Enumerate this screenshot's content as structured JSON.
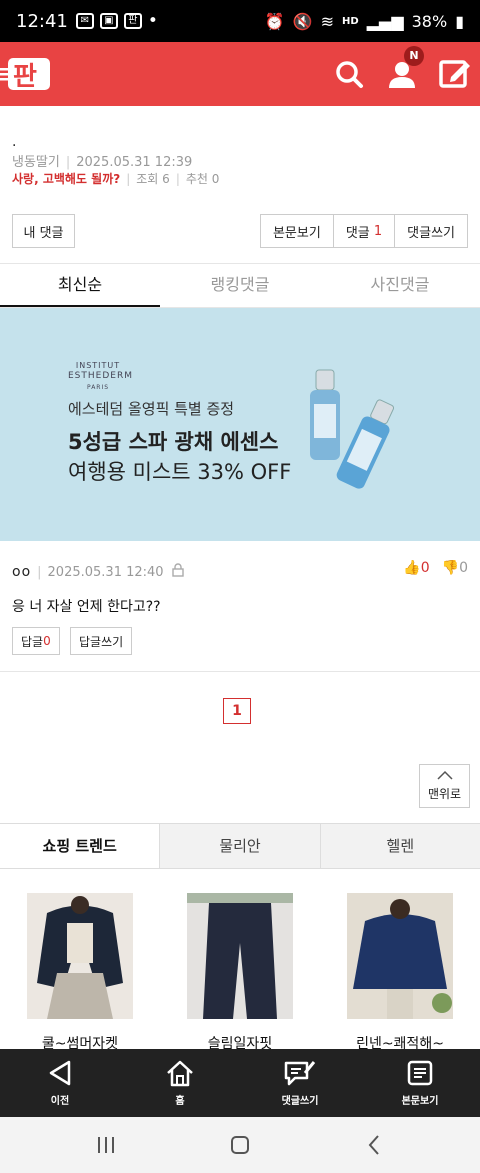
{
  "status_bar": {
    "time": "12:41",
    "battery": "38%",
    "network": "HD"
  },
  "app_bar": {
    "logo_text": "판",
    "notification_badge": "N"
  },
  "post": {
    "title": ".",
    "author": "냉동딸기",
    "datetime": "2025.05.31 12:39",
    "category": "사랑, 고백해도 될까?",
    "views_label": "조회",
    "views": "6",
    "recommend_label": "추천",
    "recommend": "0"
  },
  "actions": {
    "my_comments": "내 댓글",
    "view_post": "본문보기",
    "comments_label": "댓글",
    "comments_count": "1",
    "write_comment": "댓글쓰기"
  },
  "tabs": [
    "최신순",
    "랭킹댓글",
    "사진댓글"
  ],
  "ad": {
    "brand_line1": "INSTITUT",
    "brand_line2": "ESTHEDERM",
    "brand_line3": "PARIS",
    "subtitle": "에스테덤 올영픽 특별 증정",
    "headline1": "5성급 스파 광채 에센스",
    "headline2": "여행용 미스트 33% OFF"
  },
  "comment": {
    "nickname": "oo",
    "datetime": "2025.05.31 12:40",
    "likes": "0",
    "dislikes": "0",
    "body": "응 너 자살 언제 한다고??",
    "reply_label": "답글",
    "reply_count": "0",
    "write_reply": "답글쓰기"
  },
  "pagination": {
    "current": "1"
  },
  "to_top": "맨위로",
  "shop_tabs": [
    "쇼핑 트렌드",
    "물리안",
    "헬렌"
  ],
  "products": [
    {
      "name": "쿨~썸머자켓"
    },
    {
      "name": "슬림일자핏"
    },
    {
      "name": "린넨~쾌적해~"
    }
  ],
  "bottom_nav": [
    "이전",
    "홈",
    "댓글쓰기",
    "본문보기"
  ],
  "colors": {
    "accent": "#e84343",
    "link_red": "#d32f2f",
    "nav_bg": "#222222",
    "ad_bg": "#c5e2ec"
  }
}
